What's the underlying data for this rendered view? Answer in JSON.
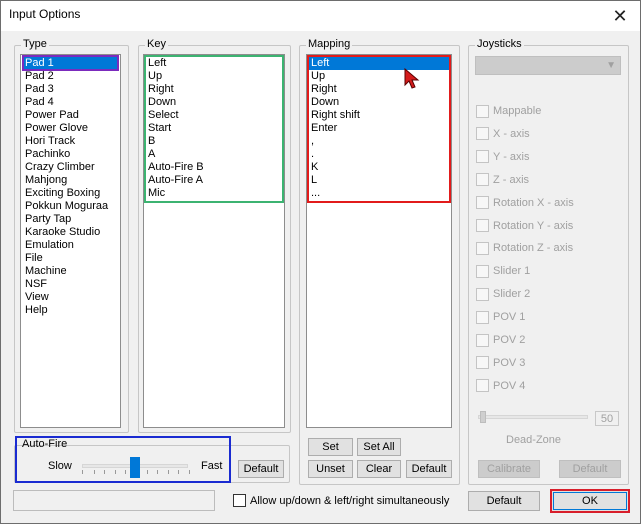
{
  "window": {
    "title": "Input Options",
    "close_glyph": "✕"
  },
  "type_group": {
    "label": "Type",
    "items": [
      "Pad 1",
      "Pad 2",
      "Pad 3",
      "Pad 4",
      "Power Pad",
      "Power Glove",
      "Hori Track",
      "Pachinko",
      "Crazy Climber",
      "Mahjong",
      "Exciting Boxing",
      "Pokkun Moguraa",
      "Party Tap",
      "Karaoke Studio",
      "Emulation",
      "File",
      "Machine",
      "NSF",
      "View",
      "Help"
    ],
    "selected_index": 0
  },
  "key_group": {
    "label": "Key",
    "items": [
      "Left",
      "Up",
      "Right",
      "Down",
      "Select",
      "Start",
      "B",
      "A",
      "Auto-Fire B",
      "Auto-Fire A",
      "Mic"
    ]
  },
  "mapping_group": {
    "label": "Mapping",
    "items": [
      "Left",
      "Up",
      "Right",
      "Down",
      "Right shift",
      "Enter",
      ",",
      ".",
      "K",
      "L",
      "..."
    ],
    "selected_index": 0,
    "buttons": {
      "set": "Set",
      "set_all": "Set All",
      "unset": "Unset",
      "clear": "Clear",
      "default": "Default"
    }
  },
  "joysticks_group": {
    "label": "Joysticks",
    "device_value": "",
    "checkboxes": [
      "Mappable",
      "X - axis",
      "Y - axis",
      "Z - axis",
      "Rotation X - axis",
      "Rotation Y - axis",
      "Rotation Z - axis",
      "Slider 1",
      "Slider 2",
      "POV 1",
      "POV 2",
      "POV 3",
      "POV 4"
    ],
    "deadzone": {
      "value": "50",
      "label": "Dead-Zone",
      "level": 0
    },
    "buttons": {
      "calibrate": "Calibrate",
      "default": "Default"
    }
  },
  "autofire": {
    "label": "Auto-Fire",
    "slow_label": "Slow",
    "fast_label": "Fast",
    "level": 0.5,
    "default_button": "Default"
  },
  "footer": {
    "status_text": "",
    "allow_checkbox_label": "Allow up/down & left/right simultaneously",
    "allow_checked": false,
    "default_button": "Default",
    "ok_button": "OK"
  },
  "highlight_colors": {
    "type": "#7b2bbd",
    "key": "#3cb371",
    "mapping": "#e21b1b",
    "autofire": "#1a2bd1",
    "ok": "#d81e2b"
  }
}
